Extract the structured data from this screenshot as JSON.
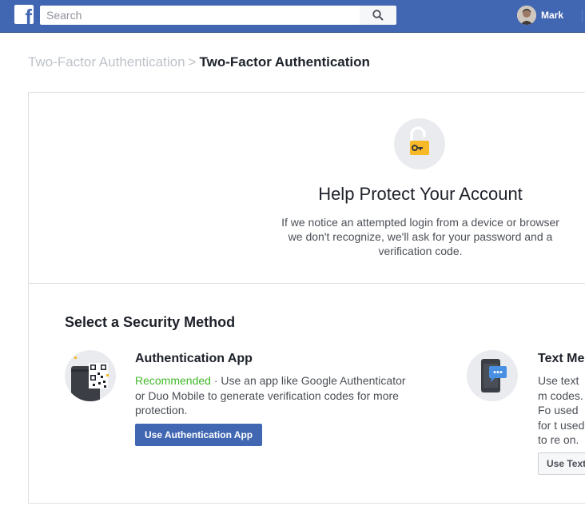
{
  "topbar": {
    "logo_letter": "f",
    "search_placeholder": "Search",
    "profile_name": "Mark"
  },
  "breadcrumb": {
    "parent": "Two-Factor Authentication",
    "separator": ">",
    "current": "Two-Factor Authentication"
  },
  "hero": {
    "title": "Help Protect Your Account",
    "text": "If we notice an attempted login from a device or browser we don't recognize, we'll ask for your password and a verification code."
  },
  "methods_section": {
    "title": "Select a Security Method",
    "methods": [
      {
        "title": "Authentication App",
        "recommended": "Recommended",
        "separator": " · ",
        "description": "Use an app like Google Authenticator or Duo Mobile to generate verification codes for more protection.",
        "button": "Use Authentication App",
        "icon": "qr-code-phone-icon"
      },
      {
        "title": "Text Mes",
        "description": "Use text m codes. Fo used for t used to re on.",
        "button": "Use Text",
        "icon": "phone-message-icon"
      }
    ]
  },
  "colors": {
    "brand": "#4267b2",
    "recommended": "#42b72a",
    "lock": "#f7b928"
  }
}
